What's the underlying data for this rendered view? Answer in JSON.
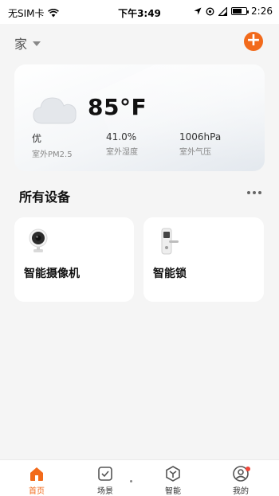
{
  "status_bar": {
    "carrier": "无SIM卡",
    "time": "下午3:49",
    "clock_right": "2:26",
    "battery_level": 0.7
  },
  "header": {
    "home_name": "家",
    "add_label": "+"
  },
  "weather": {
    "temperature": "85°F",
    "icon": "cloud-icon",
    "metrics": [
      {
        "value": "优",
        "label": "室外PM2.5"
      },
      {
        "value": "41.0%",
        "label": "室外湿度"
      },
      {
        "value": "1006hPa",
        "label": "室外气压"
      }
    ]
  },
  "devices_section": {
    "title": "所有设备"
  },
  "devices": [
    {
      "name": "智能摄像机",
      "icon": "camera-icon"
    },
    {
      "name": "智能锁",
      "icon": "smart-lock-icon"
    }
  ],
  "bottom_nav": {
    "items": [
      {
        "label": "首页",
        "icon": "home-icon",
        "active": true
      },
      {
        "label": "场景",
        "icon": "scene-icon",
        "active": false
      },
      {
        "label": "智能",
        "icon": "smart-icon",
        "active": false
      },
      {
        "label": "我的",
        "icon": "profile-icon",
        "active": false,
        "badge": true
      }
    ]
  },
  "colors": {
    "accent": "#f26a1b",
    "background": "#f5f5f5",
    "card": "#ffffff",
    "badge": "#f0473a"
  }
}
